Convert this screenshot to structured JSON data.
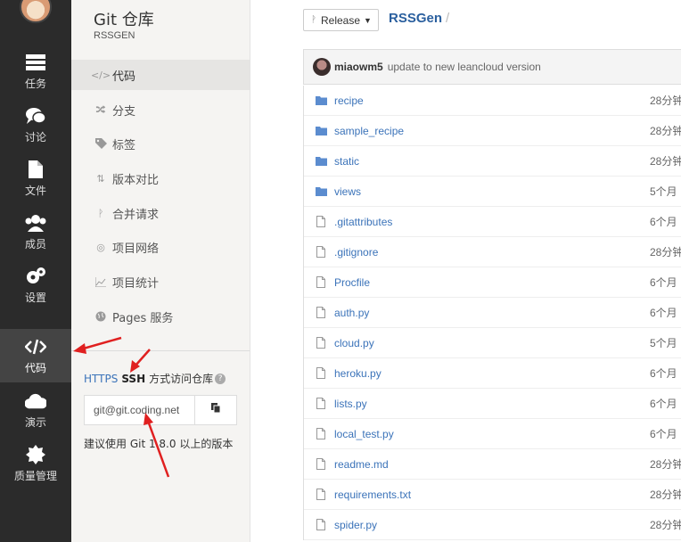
{
  "nav": {
    "items": [
      {
        "label": "任务",
        "icon": "tasks-icon"
      },
      {
        "label": "讨论",
        "icon": "discussion-icon"
      },
      {
        "label": "文件",
        "icon": "file-icon"
      },
      {
        "label": "成员",
        "icon": "members-icon"
      },
      {
        "label": "设置",
        "icon": "settings-icon"
      },
      {
        "label": "代码",
        "icon": "code-icon",
        "active": true
      },
      {
        "label": "演示",
        "icon": "cloud-icon"
      },
      {
        "label": "质量管理",
        "icon": "quality-icon"
      }
    ]
  },
  "repo": {
    "title": "Git 仓库",
    "subtitle": "RSSGEN",
    "menu": [
      {
        "label": "代码",
        "icon": "code-icon",
        "active": true
      },
      {
        "label": "分支",
        "icon": "branch-icon"
      },
      {
        "label": "标签",
        "icon": "tag-icon"
      },
      {
        "label": "版本对比",
        "icon": "compare-icon"
      },
      {
        "label": "合并请求",
        "icon": "merge-request-icon"
      },
      {
        "label": "项目网络",
        "icon": "network-icon"
      },
      {
        "label": "项目统计",
        "icon": "stats-icon"
      },
      {
        "label": "Pages 服务",
        "icon": "globe-icon"
      }
    ],
    "clone": {
      "https": "HTTPS",
      "ssh": "SSH",
      "suffix": "方式访问仓库",
      "url": "git@git.coding.net",
      "hint": "建议使用 Git 1.8.0 以上的版本"
    }
  },
  "main": {
    "branch": "Release",
    "repo_name": "RSSGen",
    "separator": "/",
    "commit": {
      "author": "miaowm5",
      "message": "update to new leancloud version"
    },
    "files": [
      {
        "name": "recipe",
        "type": "folder",
        "time": "28分钟"
      },
      {
        "name": "sample_recipe",
        "type": "folder",
        "time": "28分钟"
      },
      {
        "name": "static",
        "type": "folder",
        "time": "28分钟"
      },
      {
        "name": "views",
        "type": "folder",
        "time": "5个月"
      },
      {
        "name": ".gitattributes",
        "type": "file",
        "time": "6个月"
      },
      {
        "name": ".gitignore",
        "type": "file",
        "time": "28分钟"
      },
      {
        "name": "Procfile",
        "type": "file",
        "time": "6个月"
      },
      {
        "name": "auth.py",
        "type": "file",
        "time": "6个月"
      },
      {
        "name": "cloud.py",
        "type": "file",
        "time": "5个月"
      },
      {
        "name": "heroku.py",
        "type": "file",
        "time": "6个月"
      },
      {
        "name": "lists.py",
        "type": "file",
        "time": "6个月"
      },
      {
        "name": "local_test.py",
        "type": "file",
        "time": "6个月"
      },
      {
        "name": "readme.md",
        "type": "file",
        "time": "28分钟"
      },
      {
        "name": "requirements.txt",
        "type": "file",
        "time": "28分钟"
      },
      {
        "name": "spider.py",
        "type": "file",
        "time": "28分钟"
      }
    ]
  },
  "colors": {
    "nav_bg": "#2b2b2b",
    "link": "#3b73b9",
    "folder": "#5b8ccf",
    "annotation_arrow": "#e02020"
  }
}
